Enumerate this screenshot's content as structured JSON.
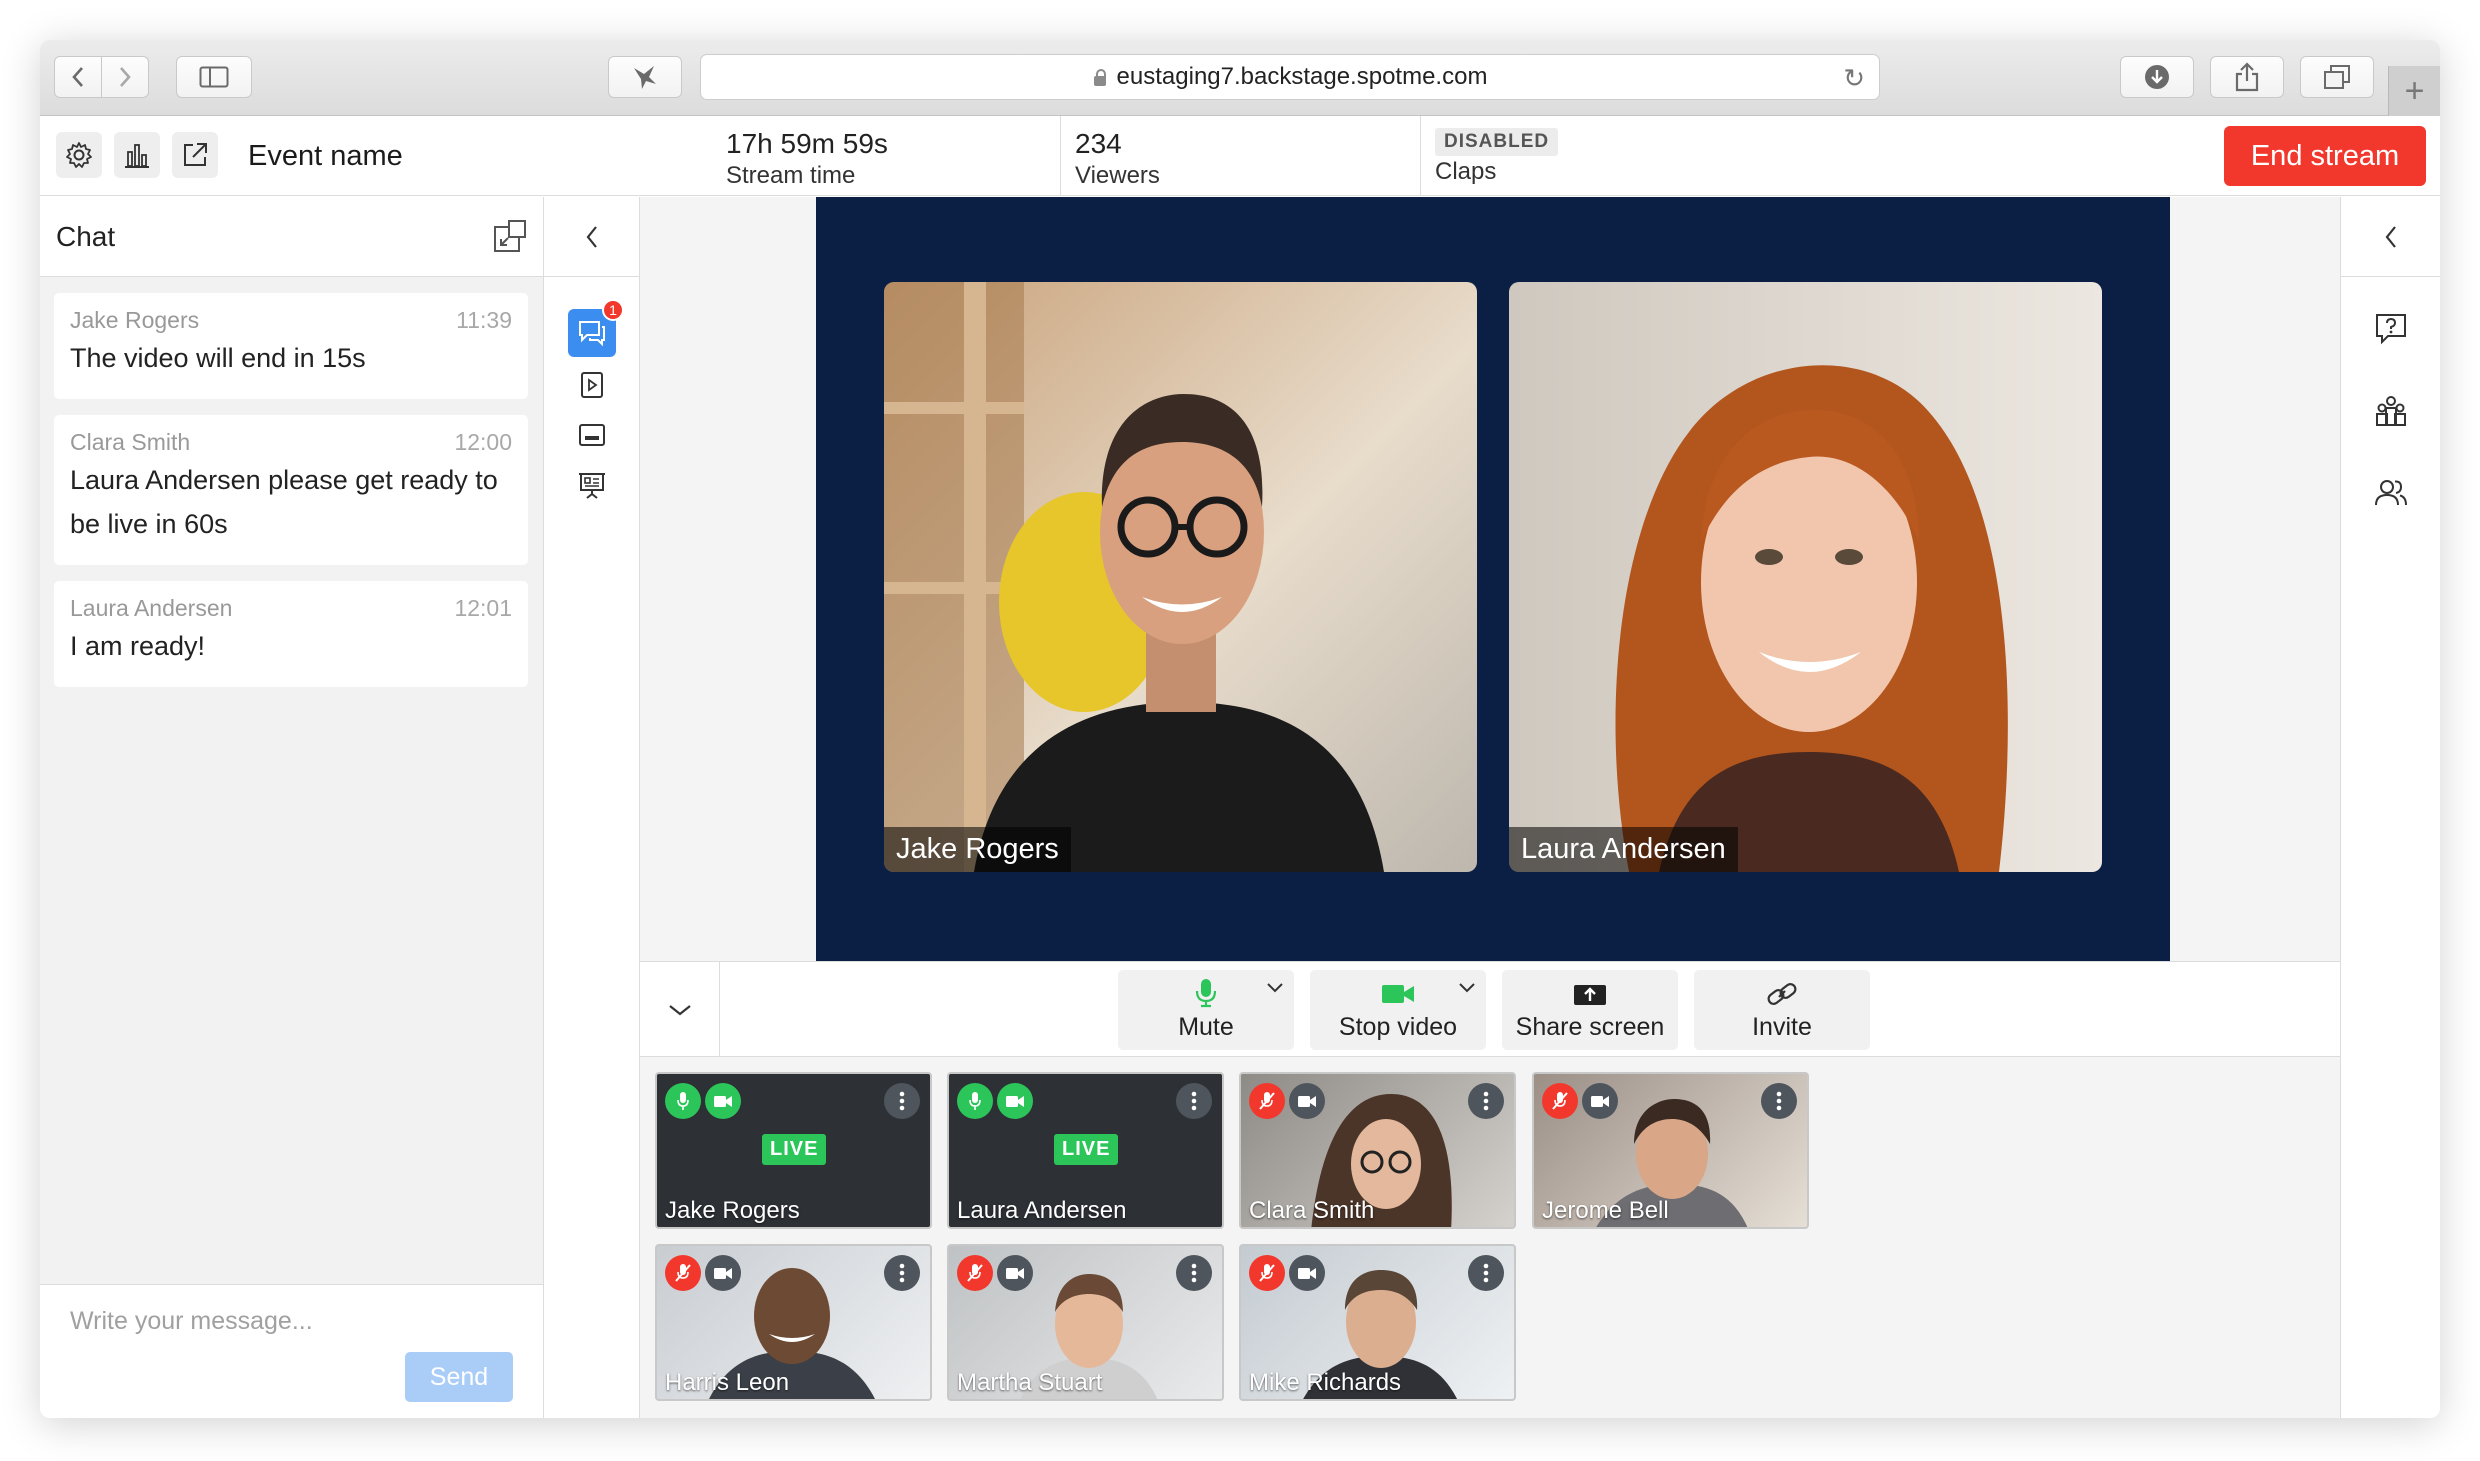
{
  "browser": {
    "url": "eustaging7.backstage.spotme.com"
  },
  "header": {
    "event_name": "Event name",
    "stream_time_value": "17h 59m 59s",
    "stream_time_label": "Stream time",
    "viewers_value": "234",
    "viewers_label": "Viewers",
    "claps_badge": "DISABLED",
    "claps_label": "Claps",
    "end_stream_label": "End stream"
  },
  "chat": {
    "title": "Chat",
    "messages": [
      {
        "author": "Jake Rogers",
        "time": "11:39",
        "text": "The video will end in 15s"
      },
      {
        "author": "Clara Smith",
        "time": "12:00",
        "text": "Laura Andersen please get ready to be live in 60s"
      },
      {
        "author": "Laura Andersen",
        "time": "12:01",
        "text": "I am ready!"
      }
    ],
    "input_placeholder": "Write your message...",
    "send_label": "Send",
    "unread_count": "1"
  },
  "stage": {
    "speakers": [
      {
        "name": "Jake Rogers"
      },
      {
        "name": "Laura Andersen"
      }
    ]
  },
  "controls": {
    "mute_label": "Mute",
    "stop_video_label": "Stop video",
    "share_screen_label": "Share screen",
    "invite_label": "Invite"
  },
  "participants": [
    {
      "name": "Jake Rogers",
      "live": "LIVE",
      "mic": "on",
      "cam": "on"
    },
    {
      "name": "Laura Andersen",
      "live": "LIVE",
      "mic": "on",
      "cam": "on"
    },
    {
      "name": "Clara Smith",
      "mic": "off",
      "cam": "on"
    },
    {
      "name": "Jerome Bell",
      "mic": "off",
      "cam": "on"
    },
    {
      "name": "Harris Leon",
      "mic": "off",
      "cam": "on"
    },
    {
      "name": "Martha Stuart",
      "mic": "off",
      "cam": "on"
    },
    {
      "name": "Mike Richards",
      "mic": "off",
      "cam": "on"
    }
  ],
  "colors": {
    "accent_blue": "#3b8ef0",
    "end_red": "#f2382d",
    "live_green": "#2cc55a",
    "stage_navy": "#0b1f45"
  }
}
